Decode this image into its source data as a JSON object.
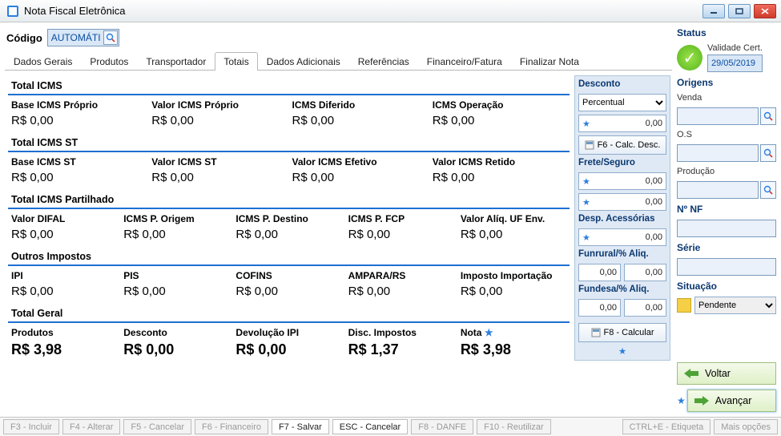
{
  "window": {
    "title": "Nota Fiscal Eletrônica"
  },
  "codigo": {
    "label": "Código",
    "value": "AUTOMÁTICO"
  },
  "tabs": [
    "Dados Gerais",
    "Produtos",
    "Transportador",
    "Totais",
    "Dados Adicionais",
    "Referências",
    "Financeiro/Fatura",
    "Finalizar Nota"
  ],
  "active_tab_index": 3,
  "sections": {
    "icms": {
      "title": "Total ICMS",
      "cols": [
        "Base ICMS Próprio",
        "Valor ICMS Próprio",
        "ICMS Diferido",
        "ICMS Operação"
      ],
      "vals": [
        "R$ 0,00",
        "R$ 0,00",
        "R$ 0,00",
        "R$ 0,00"
      ]
    },
    "icms_st": {
      "title": "Total ICMS ST",
      "cols": [
        "Base ICMS ST",
        "Valor ICMS ST",
        "Valor ICMS Efetivo",
        "Valor ICMS Retido"
      ],
      "vals": [
        "R$ 0,00",
        "R$ 0,00",
        "R$ 0,00",
        "R$ 0,00"
      ]
    },
    "partilhado": {
      "title": "Total ICMS Partilhado",
      "cols": [
        "Valor DIFAL",
        "ICMS P. Origem",
        "ICMS P. Destino",
        "ICMS P. FCP",
        "Valor Alíq. UF Env."
      ],
      "vals": [
        "R$ 0,00",
        "R$ 0,00",
        "R$ 0,00",
        "R$ 0,00",
        "R$ 0,00"
      ]
    },
    "outros": {
      "title": "Outros Impostos",
      "cols": [
        "IPI",
        "PIS",
        "COFINS",
        "AMPARA/RS",
        "Imposto Importação"
      ],
      "vals": [
        "R$ 0,00",
        "R$ 0,00",
        "R$ 0,00",
        "R$ 0,00",
        "R$ 0,00"
      ]
    },
    "geral": {
      "title": "Total Geral",
      "cols": [
        "Produtos",
        "Desconto",
        "Devolução IPI",
        "Disc. Impostos",
        "Nota"
      ],
      "vals": [
        "R$ 3,98",
        "R$ 0,00",
        "R$ 0,00",
        "R$ 1,37",
        "R$ 3,98"
      ]
    }
  },
  "side_right": {
    "desconto": {
      "label": "Desconto",
      "type": "Percentual",
      "value": "0,00",
      "calc_btn": "F6 - Calc. Desc."
    },
    "frete": {
      "label": "Frete/Seguro",
      "v1": "0,00",
      "v2": "0,00"
    },
    "despesas": {
      "label": "Desp. Acessórias",
      "value": "0,00"
    },
    "funrural": {
      "label": "Funrural/% Aliq.",
      "v1": "0,00",
      "v2": "0,00"
    },
    "fundesa": {
      "label": "Fundesa/% Aliq.",
      "v1": "0,00",
      "v2": "0,00"
    },
    "calc_btn": "F8 - Calcular"
  },
  "status": {
    "label": "Status",
    "validade_label": "Validade Cert.",
    "validade_value": "29/05/2019",
    "origens_label": "Origens",
    "origem_venda_label": "Venda",
    "origem_os_label": "O.S",
    "origem_producao_label": "Produção",
    "nf_label": "Nº NF",
    "serie_label": "Série",
    "situacao_label": "Situação",
    "situacao_value": "Pendente",
    "voltar": "Voltar",
    "avancar": "Avançar"
  },
  "bottom": [
    "F3 - Incluir",
    "F4 - Alterar",
    "F5 - Cancelar",
    "F6 - Financeiro",
    "F7 - Salvar",
    "ESC - Cancelar",
    "F8 - DANFE",
    "F10 - Reutilizar",
    "CTRL+E - Etiqueta",
    "Mais opções"
  ],
  "bottom_active": [
    4,
    5
  ]
}
